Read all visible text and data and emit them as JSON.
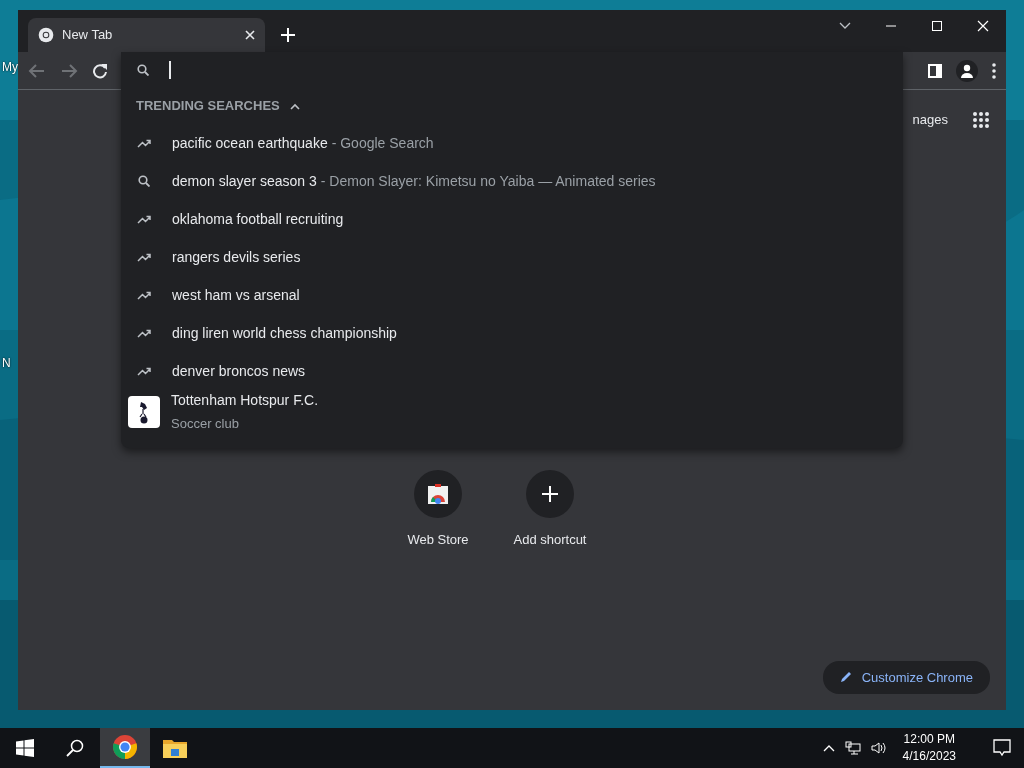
{
  "desktop": {
    "labels": [
      "My",
      "N"
    ]
  },
  "browser": {
    "tabs": [
      {
        "title": "New Tab",
        "selected": true
      }
    ]
  },
  "suggestions": {
    "heading": "TRENDING SEARCHES",
    "expanded": true,
    "items": [
      {
        "kind": "trend",
        "text": "pacific ocean earthquake",
        "detail": "- Google Search"
      },
      {
        "kind": "search",
        "text": "demon slayer season 3",
        "detail": "- Demon Slayer: Kimetsu no Yaiba — Animated series"
      },
      {
        "kind": "trend",
        "text": "oklahoma football recruiting"
      },
      {
        "kind": "trend",
        "text": "rangers devils series"
      },
      {
        "kind": "trend",
        "text": "west ham vs arsenal"
      },
      {
        "kind": "trend",
        "text": "ding liren world chess championship"
      },
      {
        "kind": "trend",
        "text": "denver broncos news"
      },
      {
        "kind": "entity",
        "text": "Tottenham Hotspur F.C.",
        "detail": "Soccer club"
      }
    ]
  },
  "page": {
    "header_link": "nages",
    "shortcuts": [
      {
        "kind": "store",
        "label": "Web Store"
      },
      {
        "kind": "add",
        "label": "Add shortcut"
      }
    ],
    "customize_button": "Customize Chrome"
  },
  "taskbar": {
    "apps": [
      {
        "kind": "chrome",
        "selected": true
      },
      {
        "kind": "explorer",
        "selected": false
      }
    ],
    "time": "12:00 PM",
    "date": "4/16/2023"
  }
}
